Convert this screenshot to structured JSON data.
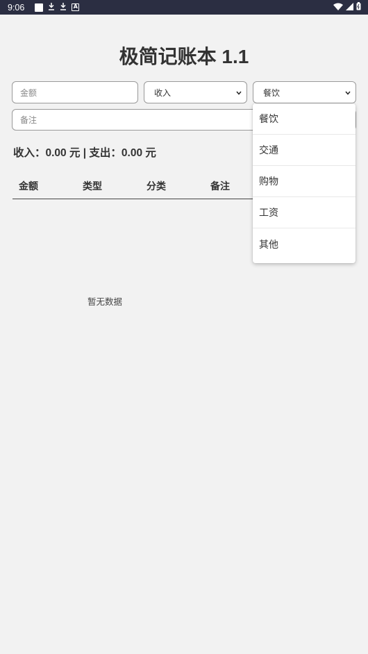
{
  "status_bar": {
    "time": "9:06",
    "left_icons": [
      "notification-square-icon",
      "download-icon",
      "download-icon",
      "a-box-icon"
    ],
    "right_icons": [
      "wifi-icon",
      "signal-icon",
      "battery-icon"
    ]
  },
  "title": "极简记账本 1.1",
  "form": {
    "amount_placeholder": "金额",
    "type_value": "收入",
    "category_value": "餐饮",
    "note_placeholder": "备注"
  },
  "summary": "收入：0.00 元 | 支出：0.00 元",
  "table": {
    "headers": [
      "金额",
      "类型",
      "分类",
      "备注"
    ],
    "empty_text": "暂无数据"
  },
  "category_dropdown": {
    "options": [
      "餐饮",
      "交通",
      "购物",
      "工资",
      "其他"
    ]
  }
}
